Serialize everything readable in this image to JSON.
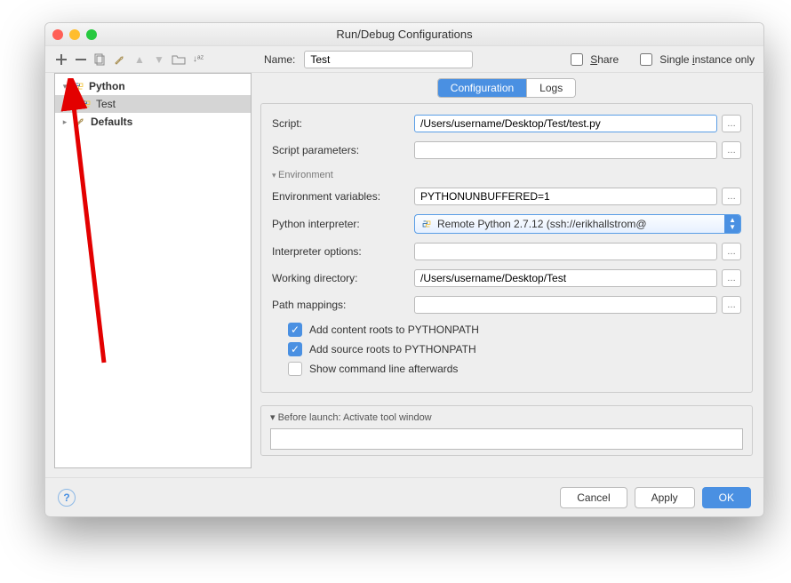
{
  "window": {
    "title": "Run/Debug Configurations",
    "traffic": {
      "close": "#ff5f56",
      "min": "#ffbd2e",
      "max": "#27c93f"
    }
  },
  "top": {
    "name_label": "Name:",
    "name_value": "Test",
    "share_label": "Share",
    "single_instance_label": "Single instance only"
  },
  "sidebar": {
    "items": [
      {
        "label": "Python",
        "bold": true,
        "indent": 0,
        "arrow": "▾"
      },
      {
        "label": "Test",
        "bold": false,
        "indent": 1,
        "selected": true
      },
      {
        "label": "Defaults",
        "bold": true,
        "indent": 0,
        "arrow": "▸"
      }
    ]
  },
  "tabs": {
    "configuration": "Configuration",
    "logs": "Logs"
  },
  "form": {
    "script_label": "Script:",
    "script_value": "/Users/username/Desktop/Test/test.py",
    "script_params_label": "Script parameters:",
    "script_params_value": "",
    "env_section": "Environment",
    "env_vars_label": "Environment variables:",
    "env_vars_value": "PYTHONUNBUFFERED=1",
    "interpreter_label": "Python interpreter:",
    "interpreter_value": "Remote Python 2.7.12 (ssh://erikhallstrom@",
    "interpreter_opts_label": "Interpreter options:",
    "interpreter_opts_value": "",
    "working_dir_label": "Working directory:",
    "working_dir_value": "/Users/username/Desktop/Test",
    "path_mappings_label": "Path mappings:",
    "path_mappings_value": "",
    "add_content_roots": "Add content roots to PYTHONPATH",
    "add_source_roots": "Add source roots to PYTHONPATH",
    "show_cmdline": "Show command line afterwards"
  },
  "before": {
    "title": "Before launch: Activate tool window"
  },
  "footer": {
    "cancel": "Cancel",
    "apply": "Apply",
    "ok": "OK"
  }
}
